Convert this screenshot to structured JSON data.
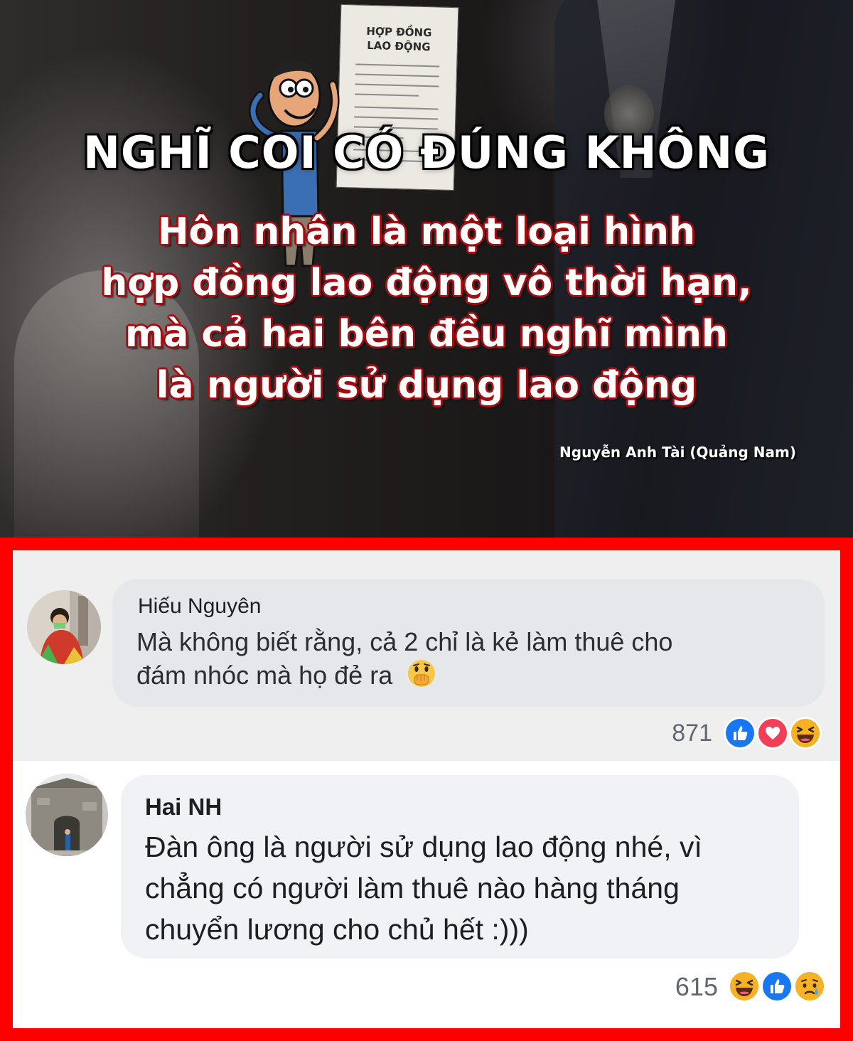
{
  "poster": {
    "document_label_line1": "HỢP ĐỒNG",
    "document_label_line2": "LAO ĐỘNG",
    "headline": "NGHĨ COI CÓ ĐÚNG KHÔNG",
    "quote_lines": [
      "Hôn nhân là một loại hình",
      "hợp đồng lao động vô thời hạn,",
      "mà cả hai bên đều nghĩ mình",
      "là người sử dụng lao động"
    ],
    "author": "Nguyễn Anh Tài (Quảng Nam)",
    "colors": {
      "quote_outline": "#a40d12",
      "headline_text": "#ffffff"
    }
  },
  "comments": [
    {
      "name": "Hiếu Nguyên",
      "text_lines": [
        "Mà không biết rằng, cả 2 chỉ là kẻ làm thuê cho",
        "đám nhóc mà họ đẻ ra"
      ],
      "inline_emoji": "face-with-hand-over-mouth-icon",
      "reaction_count": "871",
      "reactions": [
        "like-icon",
        "love-icon",
        "haha-icon"
      ]
    },
    {
      "name": "Hai NH",
      "text_lines": [
        "Đàn ông là người sử dụng lao động nhé, vì",
        "chẳng có người làm thuê nào hàng tháng",
        "chuyển lương cho chủ hết :)))"
      ],
      "reaction_count": "615",
      "reactions": [
        "haha-icon",
        "like-icon",
        "sad-icon"
      ]
    }
  ],
  "colors": {
    "frame": "#ff0000",
    "bubble": "#f0f2f5",
    "like": "#1877f2",
    "love": "#f33e58",
    "haha": "#f7b125"
  }
}
